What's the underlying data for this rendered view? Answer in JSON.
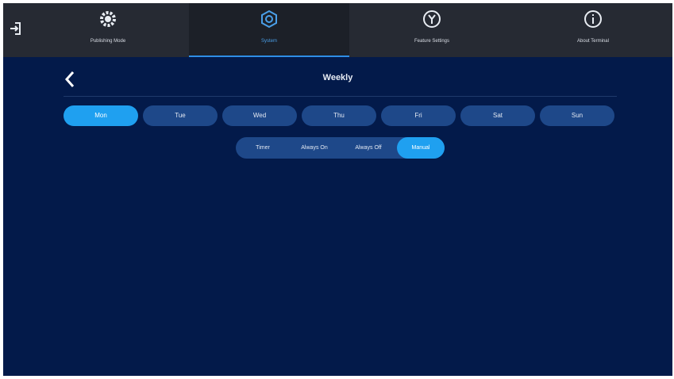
{
  "nav": {
    "tabs": [
      {
        "label": "Publishing Mode",
        "icon": "gear-icon"
      },
      {
        "label": "System",
        "icon": "settings-icon"
      },
      {
        "label": "Feature Settings",
        "icon": "feature-icon"
      },
      {
        "label": "About Terminal",
        "icon": "info-icon"
      }
    ],
    "active_tab": "System",
    "exit_icon": "exit-icon"
  },
  "page": {
    "title": "Weekly",
    "back_icon": "back-icon"
  },
  "days": [
    "Mon",
    "Tue",
    "Wed",
    "Thu",
    "Fri",
    "Sat",
    "Sun"
  ],
  "selected_day": "Mon",
  "modes": [
    "Timer",
    "Always On",
    "Always Off",
    "Manual"
  ],
  "selected_mode": "Manual",
  "colors": {
    "background": "#031a4a",
    "topbar": "#262a33",
    "accent": "#1fa0f0",
    "chip": "#1e4889"
  }
}
